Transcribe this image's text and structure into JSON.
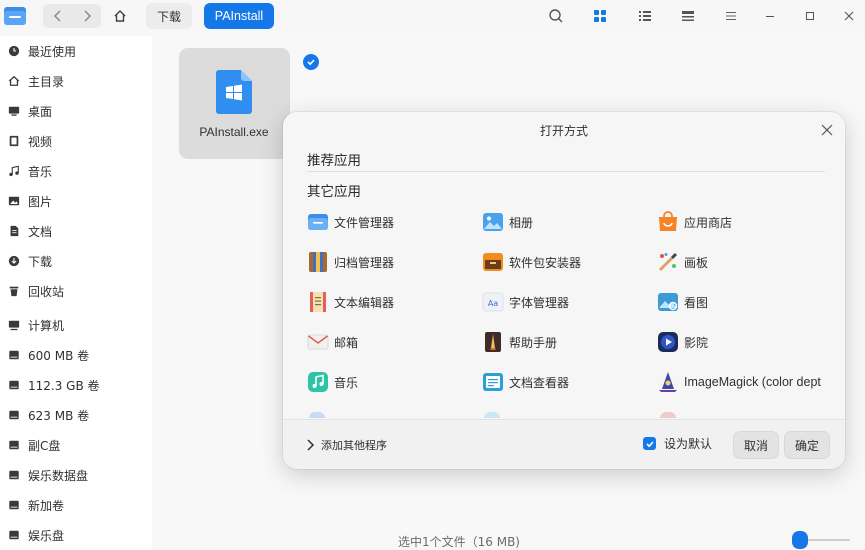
{
  "breadcrumb": {
    "download": "下载",
    "current": "PAInstall"
  },
  "sidebar": {
    "items": [
      {
        "label": "最近使用",
        "icon": "clock-icon"
      },
      {
        "label": "主目录",
        "icon": "home-icon"
      },
      {
        "label": "桌面",
        "icon": "desktop-icon"
      },
      {
        "label": "视频",
        "icon": "video-icon"
      },
      {
        "label": "音乐",
        "icon": "music-icon"
      },
      {
        "label": "图片",
        "icon": "image-icon"
      },
      {
        "label": "文档",
        "icon": "document-icon"
      },
      {
        "label": "下载",
        "icon": "download-icon"
      },
      {
        "label": "回收站",
        "icon": "trash-icon"
      },
      {
        "label": "计算机",
        "icon": "computer-icon"
      },
      {
        "label": "600 MB 卷",
        "icon": "disk-icon"
      },
      {
        "label": "112.3 GB 卷",
        "icon": "disk-icon"
      },
      {
        "label": "623 MB 卷",
        "icon": "disk-icon"
      },
      {
        "label": "副C盘",
        "icon": "disk-icon"
      },
      {
        "label": "娱乐数据盘",
        "icon": "disk-icon"
      },
      {
        "label": "新加卷",
        "icon": "disk-icon"
      },
      {
        "label": "娱乐盘",
        "icon": "disk-icon"
      }
    ]
  },
  "file": {
    "name": "PAInstall.exe"
  },
  "status": {
    "text": "选中1个文件（16 MB)"
  },
  "zoom": {
    "level": 0.3
  },
  "dialog": {
    "title": "打开方式",
    "recommended_title": "推荐应用",
    "other_title": "其它应用",
    "apps": [
      {
        "label": "文件管理器",
        "icon": "file-manager-icon"
      },
      {
        "label": "相册",
        "icon": "album-icon"
      },
      {
        "label": "应用商店",
        "icon": "app-store-icon"
      },
      {
        "label": "归档管理器",
        "icon": "archive-manager-icon"
      },
      {
        "label": "软件包安装器",
        "icon": "package-installer-icon"
      },
      {
        "label": "画板",
        "icon": "draw-board-icon"
      },
      {
        "label": "文本编辑器",
        "icon": "text-editor-icon"
      },
      {
        "label": "字体管理器",
        "icon": "font-manager-icon"
      },
      {
        "label": "看图",
        "icon": "image-viewer-icon"
      },
      {
        "label": "邮箱",
        "icon": "mail-icon"
      },
      {
        "label": "帮助手册",
        "icon": "help-manual-icon"
      },
      {
        "label": "影院",
        "icon": "movie-icon"
      },
      {
        "label": "音乐",
        "icon": "music-app-icon"
      },
      {
        "label": "文档查看器",
        "icon": "document-viewer-icon"
      },
      {
        "label": "ImageMagick (color dept",
        "icon": "imagemagick-icon"
      }
    ],
    "add_other": "添加其他程序",
    "set_default": "设为默认",
    "cancel": "取消",
    "confirm": "确定"
  },
  "colors": {
    "accent": "#1478e8",
    "sidebar_bg": "#ffffff",
    "dialog_bg": "#f6f6f6"
  }
}
